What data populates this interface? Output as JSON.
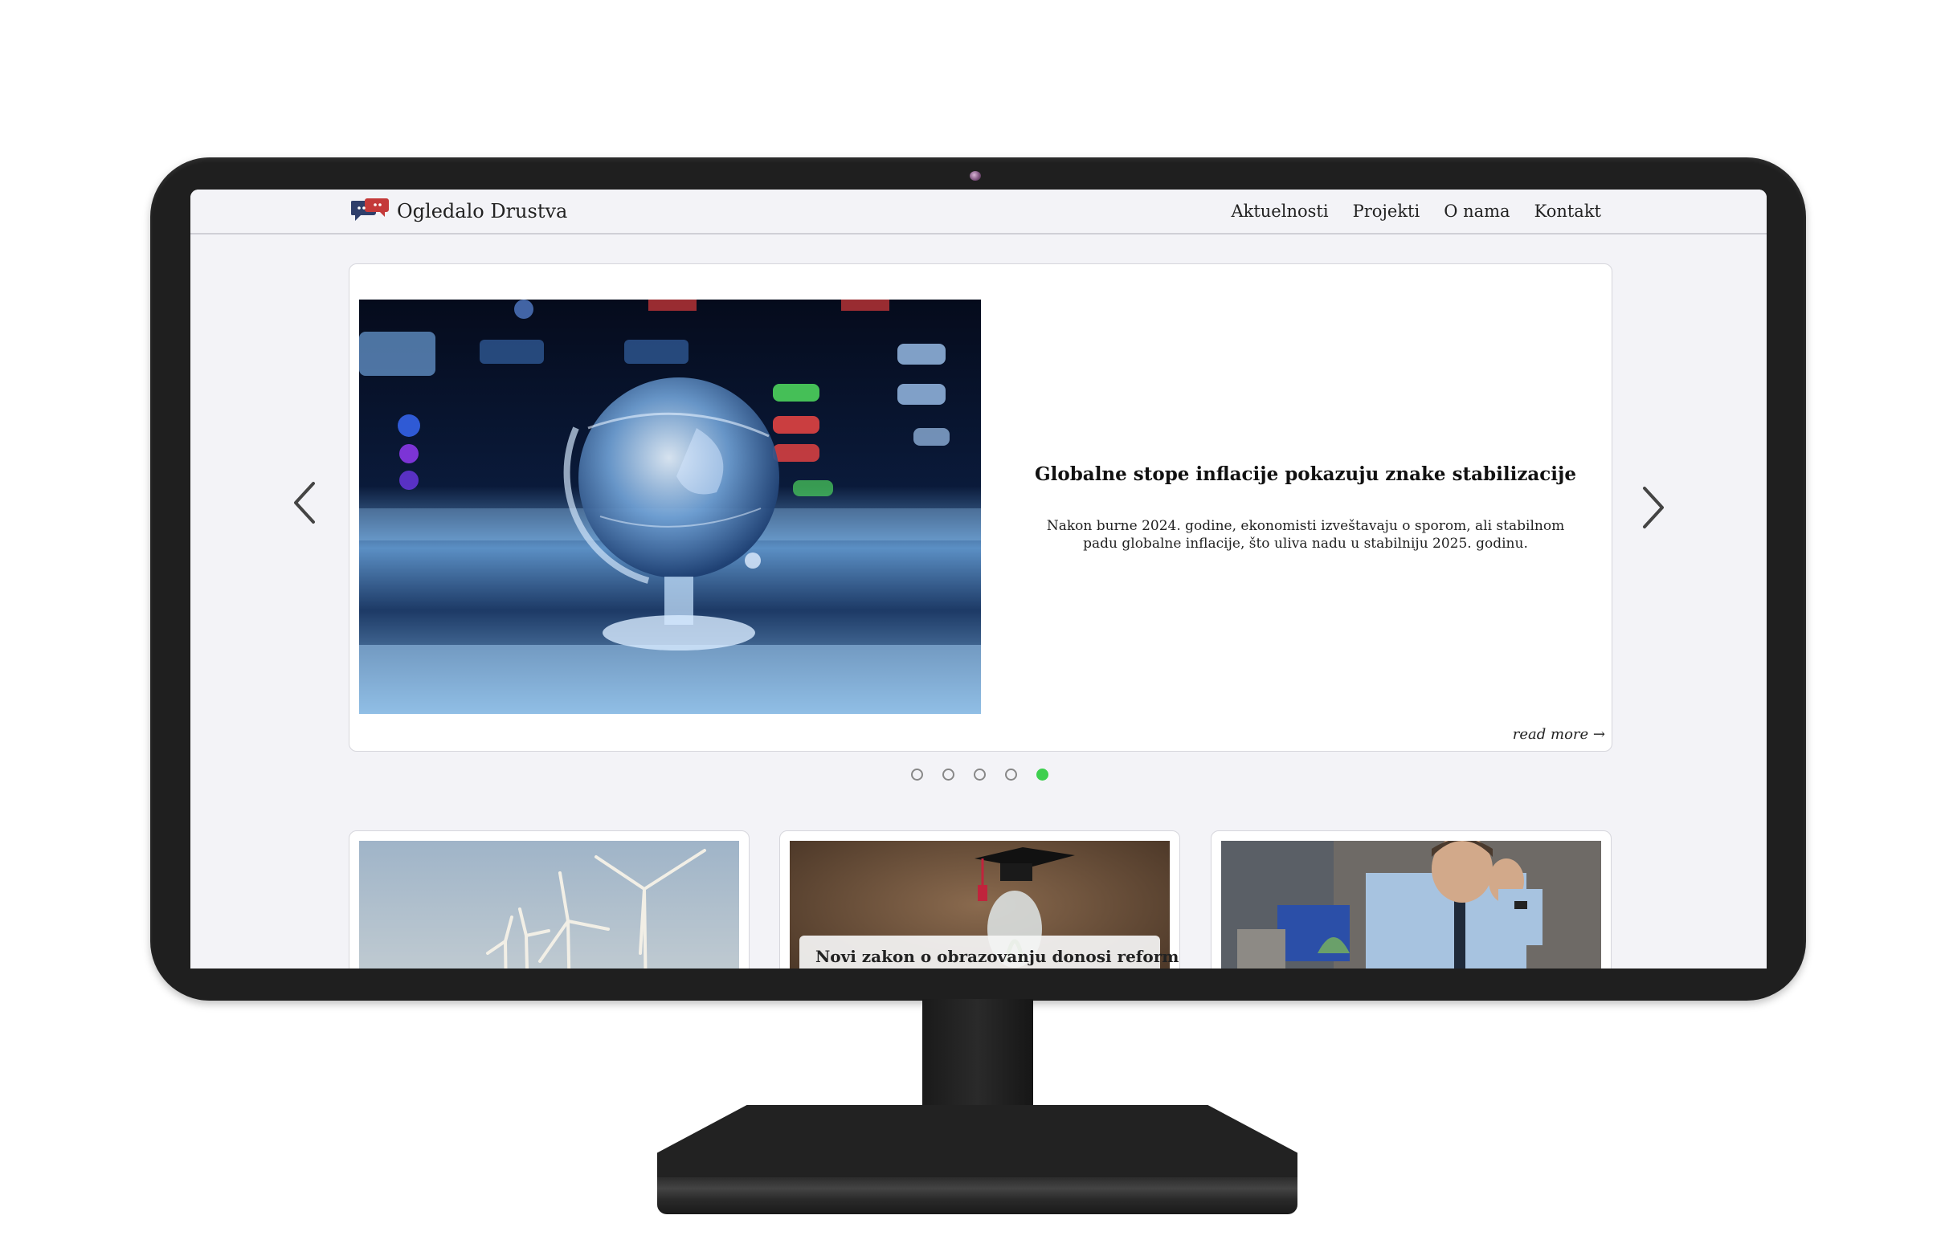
{
  "site": {
    "brand": "Ogledalo Drustva"
  },
  "nav": {
    "items": [
      "Aktuelnosti",
      "Projekti",
      "O nama",
      "Kontakt"
    ]
  },
  "hero": {
    "title": "Globalne stope inflacije pokazuju znake stabilizacije",
    "description": "Nakon burne 2024. godine, ekonomisti izveštavaju o sporom, ali stabilnom padu globalne inflacije, što uliva nadu u stabilniju 2025. godinu.",
    "read_more": "read more →",
    "image": "crystal-globe-over-trading-screen"
  },
  "carousel": {
    "slide_count": 5,
    "active_index": 4,
    "active_color": "#3ecf4f"
  },
  "cards": [
    {
      "image": "wind-turbines",
      "title": ""
    },
    {
      "image": "graduation-cap-lightbulb",
      "title": "Novi zakon o obrazovanju donosi reforme"
    },
    {
      "image": "stressed-businessman",
      "title": ""
    }
  ],
  "icons": {
    "logo": "speech-bubbles-logo",
    "prev": "chevron-left-icon",
    "next": "chevron-right-icon"
  }
}
